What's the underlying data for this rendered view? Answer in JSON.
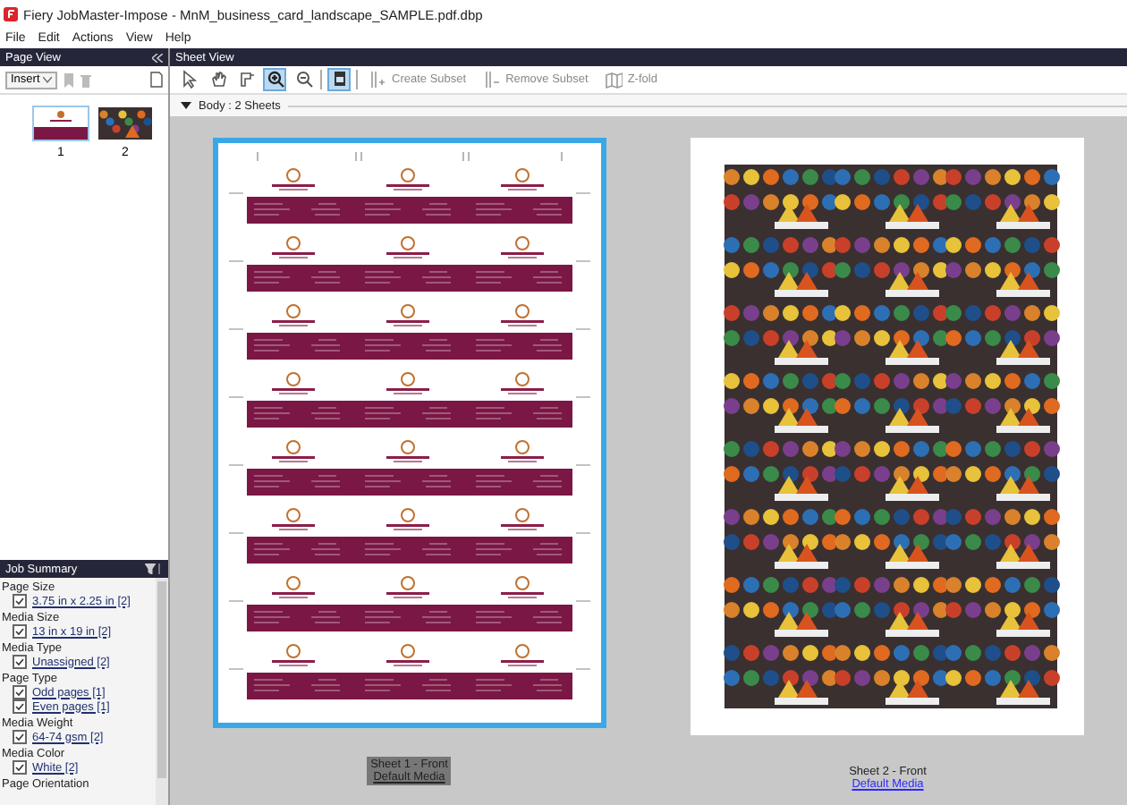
{
  "window": {
    "title": "Fiery JobMaster-Impose - MnM_business_card_landscape_SAMPLE.pdf.dbp"
  },
  "menu": [
    "File",
    "Edit",
    "Actions",
    "View",
    "Help"
  ],
  "page_view": {
    "title": "Page View",
    "insert_label": "Insert",
    "pages": [
      {
        "label": "1",
        "kind": "card",
        "selected": true
      },
      {
        "label": "2",
        "kind": "photo",
        "selected": false
      }
    ]
  },
  "job_summary": {
    "title": "Job Summary",
    "groups": [
      {
        "heading": "Page Size",
        "items": [
          {
            "label": "3.75 in x 2.25 in [2]",
            "checked": true
          }
        ]
      },
      {
        "heading": "Media Size",
        "items": [
          {
            "label": "13 in x 19 in [2]",
            "checked": true
          }
        ]
      },
      {
        "heading": "Media Type",
        "items": [
          {
            "label": "Unassigned [2]",
            "checked": true
          }
        ]
      },
      {
        "heading": "Page Type",
        "items": [
          {
            "label": "Odd pages [1]",
            "checked": true
          },
          {
            "label": "Even pages [1]",
            "checked": true
          }
        ]
      },
      {
        "heading": "Media Weight",
        "items": [
          {
            "label": "64-74 gsm [2]",
            "checked": true
          }
        ]
      },
      {
        "heading": "Media Color",
        "items": [
          {
            "label": "White [2]",
            "checked": true
          }
        ]
      },
      {
        "heading": "Page Orientation"
      }
    ]
  },
  "sheet_view": {
    "title": "Sheet View",
    "tools": [
      {
        "kind": "pointer",
        "selected": false
      },
      {
        "kind": "hand",
        "selected": false
      },
      {
        "kind": "trim",
        "selected": false
      },
      {
        "kind": "zoom-in",
        "selected": true
      },
      {
        "kind": "zoom-out",
        "selected": false
      }
    ],
    "layout_tools": [
      {
        "kind": "page",
        "selected": true
      }
    ],
    "actions": [
      {
        "label": "Create Subset",
        "kind": "create",
        "disabled": true
      },
      {
        "label": "Remove Subset",
        "kind": "remove",
        "disabled": true
      },
      {
        "label": "Z-fold",
        "kind": "zfold",
        "disabled": true
      }
    ],
    "section": "Body : 2 Sheets",
    "sheets": [
      {
        "kind": "cards",
        "selected": true,
        "name": "Sheet 1 - Front",
        "media": "Default Media"
      },
      {
        "kind": "photos",
        "selected": false,
        "name": "Sheet 2 - Front",
        "media": "Default Media"
      }
    ]
  }
}
